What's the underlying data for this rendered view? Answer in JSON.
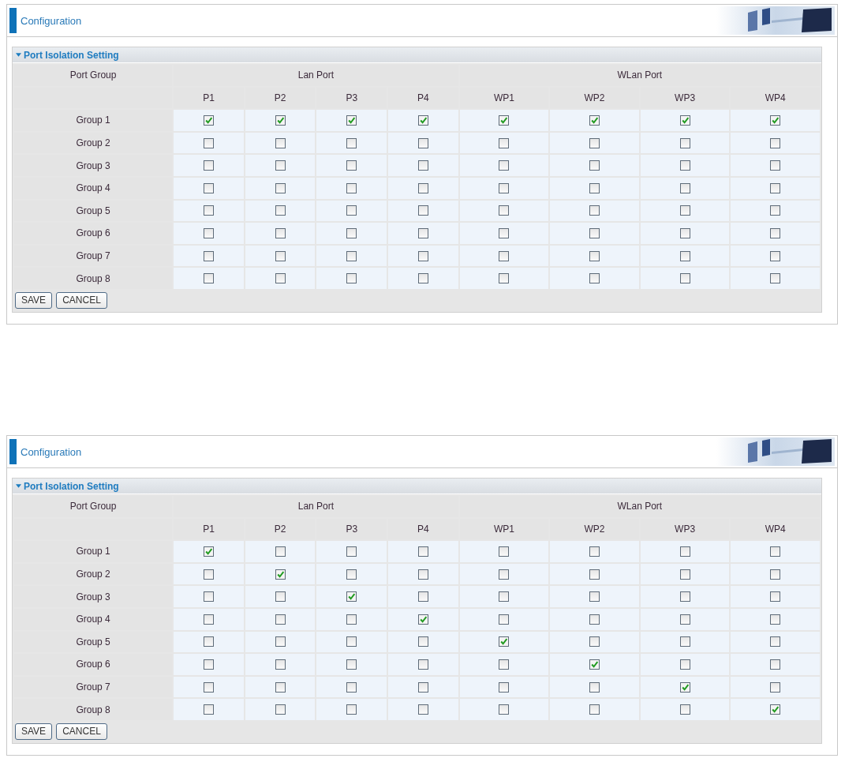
{
  "panels": [
    {
      "title": "Configuration",
      "section": "Port Isolation Setting",
      "corner_label": "Port Group",
      "groups": [
        {
          "label": "Lan Port",
          "ports": [
            "P1",
            "P2",
            "P3",
            "P4"
          ]
        },
        {
          "label": "WLan Port",
          "ports": [
            "WP1",
            "WP2",
            "WP3",
            "WP4"
          ]
        }
      ],
      "rows": [
        {
          "label": "Group 1",
          "checked": [
            true,
            true,
            true,
            true,
            true,
            true,
            true,
            true
          ]
        },
        {
          "label": "Group 2",
          "checked": [
            false,
            false,
            false,
            false,
            false,
            false,
            false,
            false
          ]
        },
        {
          "label": "Group 3",
          "checked": [
            false,
            false,
            false,
            false,
            false,
            false,
            false,
            false
          ]
        },
        {
          "label": "Group 4",
          "checked": [
            false,
            false,
            false,
            false,
            false,
            false,
            false,
            false
          ]
        },
        {
          "label": "Group 5",
          "checked": [
            false,
            false,
            false,
            false,
            false,
            false,
            false,
            false
          ]
        },
        {
          "label": "Group 6",
          "checked": [
            false,
            false,
            false,
            false,
            false,
            false,
            false,
            false
          ]
        },
        {
          "label": "Group 7",
          "checked": [
            false,
            false,
            false,
            false,
            false,
            false,
            false,
            false
          ]
        },
        {
          "label": "Group 8",
          "checked": [
            false,
            false,
            false,
            false,
            false,
            false,
            false,
            false
          ]
        }
      ],
      "buttons": [
        "SAVE",
        "CANCEL"
      ]
    },
    {
      "title": "Configuration",
      "section": "Port Isolation Setting",
      "corner_label": "Port Group",
      "groups": [
        {
          "label": "Lan Port",
          "ports": [
            "P1",
            "P2",
            "P3",
            "P4"
          ]
        },
        {
          "label": "WLan Port",
          "ports": [
            "WP1",
            "WP2",
            "WP3",
            "WP4"
          ]
        }
      ],
      "rows": [
        {
          "label": "Group 1",
          "checked": [
            true,
            false,
            false,
            false,
            false,
            false,
            false,
            false
          ]
        },
        {
          "label": "Group 2",
          "checked": [
            false,
            true,
            false,
            false,
            false,
            false,
            false,
            false
          ]
        },
        {
          "label": "Group 3",
          "checked": [
            false,
            false,
            true,
            false,
            false,
            false,
            false,
            false
          ]
        },
        {
          "label": "Group 4",
          "checked": [
            false,
            false,
            false,
            true,
            false,
            false,
            false,
            false
          ]
        },
        {
          "label": "Group 5",
          "checked": [
            false,
            false,
            false,
            false,
            true,
            false,
            false,
            false
          ]
        },
        {
          "label": "Group 6",
          "checked": [
            false,
            false,
            false,
            false,
            false,
            true,
            false,
            false
          ]
        },
        {
          "label": "Group 7",
          "checked": [
            false,
            false,
            false,
            false,
            false,
            false,
            true,
            false
          ]
        },
        {
          "label": "Group 8",
          "checked": [
            false,
            false,
            false,
            false,
            false,
            false,
            false,
            true
          ]
        }
      ],
      "buttons": [
        "SAVE",
        "CANCEL"
      ]
    }
  ]
}
